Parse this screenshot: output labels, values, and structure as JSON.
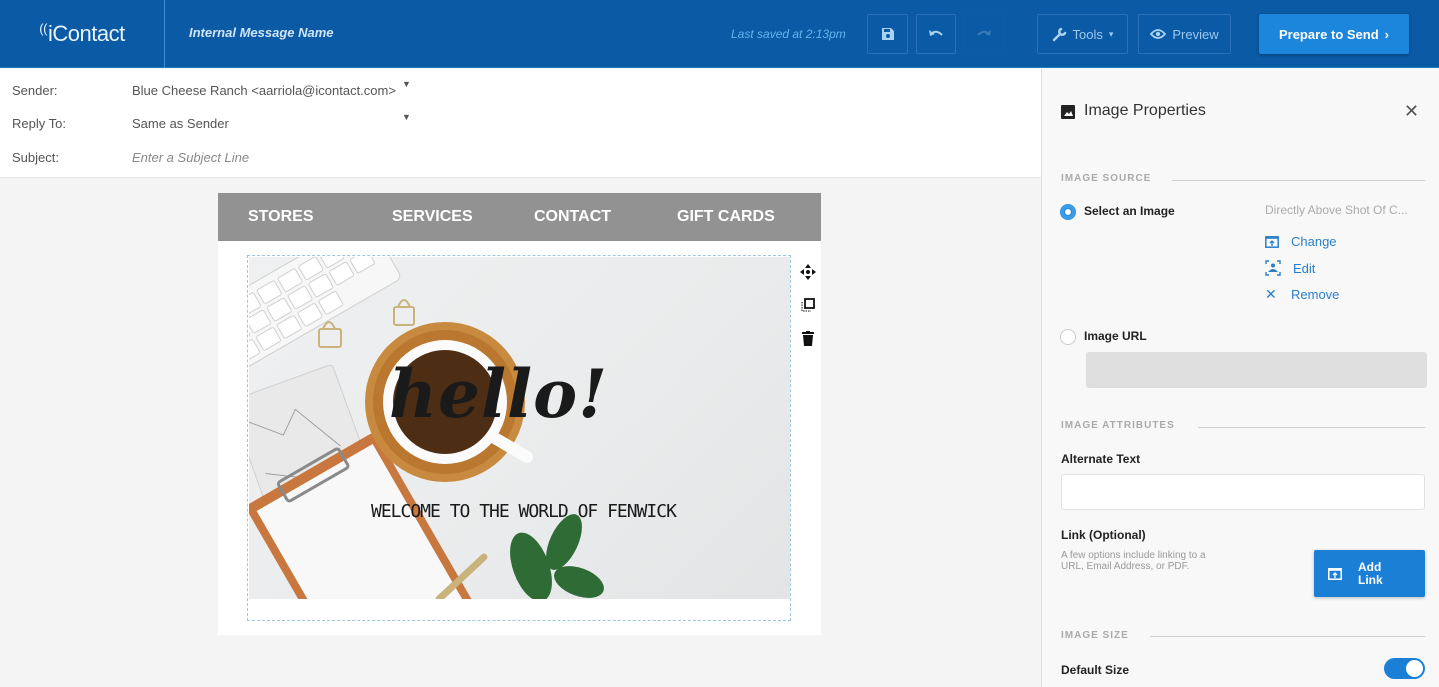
{
  "topbar": {
    "logo": "iContact",
    "message_name": "Internal Message Name",
    "last_saved": "Last saved at 2:13pm",
    "tools_label": "Tools",
    "preview_label": "Preview",
    "send_label": "Prepare to Send"
  },
  "fields": {
    "sender_label": "Sender:",
    "sender_value": "Blue Cheese Ranch <aarriola@icontact.com>",
    "reply_label": "Reply To:",
    "reply_value": "Same as Sender",
    "subject_label": "Subject:",
    "subject_placeholder": "Enter a Subject Line"
  },
  "email": {
    "nav": [
      "STORES",
      "SERVICES",
      "CONTACT",
      "GIFT CARDS"
    ],
    "hero_title": "hello!",
    "hero_subtitle": "WELCOME TO THE WORLD OF FENWICK"
  },
  "panel": {
    "title": "Image Properties",
    "image_source_heading": "IMAGE SOURCE",
    "select_image_label": "Select an Image",
    "selected_image_name": "Directly Above Shot Of C...",
    "change_label": "Change",
    "edit_label": "Edit",
    "remove_label": "Remove",
    "image_url_label": "Image URL",
    "image_url_value": "",
    "image_attributes_heading": "IMAGE ATTRIBUTES",
    "alt_text_label": "Alternate Text",
    "alt_text_value": "",
    "link_label": "Link (Optional)",
    "link_help": "A few options include linking to a URL, Email Address, or PDF.",
    "add_link_line1": "Add",
    "add_link_line2": "Link",
    "image_size_heading": "IMAGE SIZE",
    "default_size_label": "Default Size",
    "default_size_on": true
  },
  "colors": {
    "topbar": "#0a5aa5",
    "accent": "#1c86dc",
    "nav_bg": "#929292"
  }
}
